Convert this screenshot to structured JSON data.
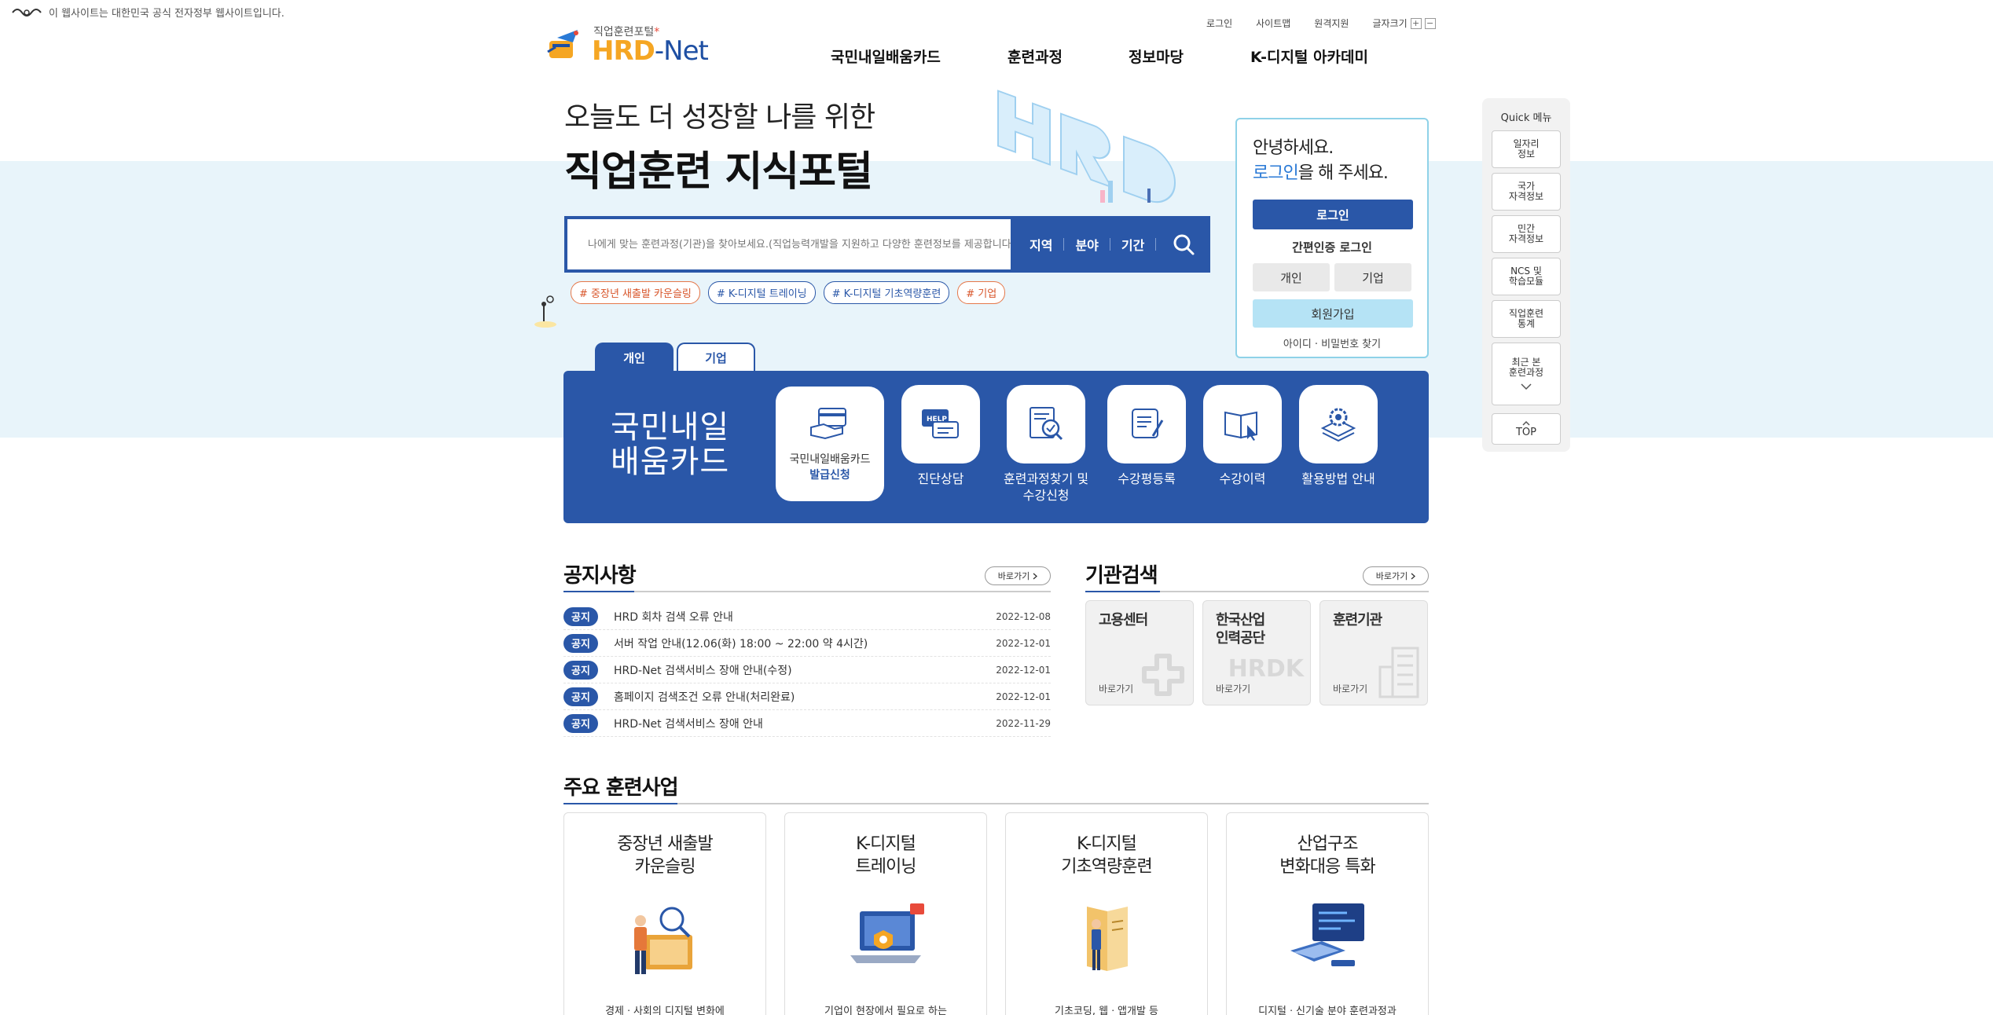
{
  "gov_banner": {
    "text": "이 웹사이트는 대한민국 공식 전자정부 웹사이트입니다."
  },
  "util_nav": {
    "login": "로그인",
    "sitemap": "사이트맵",
    "remote": "원격지원",
    "font_size": "글자크기",
    "plus": "+",
    "minus": "−"
  },
  "logo": {
    "sub": "직업훈련포털",
    "star": "*",
    "main": "HRD",
    "net": "Net",
    "dash": "-"
  },
  "gnb": [
    "국민내일배움카드",
    "훈련과정",
    "정보마당",
    "K-디지털 아카데미"
  ],
  "hero": {
    "line1": "오늘도 더 성장할 나를 위한",
    "line2": "직업훈련 지식포털"
  },
  "search": {
    "placeholder": "나에게 맞는 훈련과정(기관)을 찾아보세요.(직업능력개발을 지원하고 다양한 훈련정보를 제공합니다.)",
    "filters": [
      "지역",
      "분야",
      "기간"
    ]
  },
  "tags": [
    "# 중장년 새출발 카운슬링",
    "# K-디지털 트레이닝",
    "# K-디지털 기초역량훈련",
    "# 기업"
  ],
  "login_panel": {
    "hello": "안녕하세요.",
    "prompt_hl": "로그인",
    "prompt_rest": "을 해 주세요.",
    "login_button": "로그인",
    "simple_login": "간편인증 로그인",
    "personal": "개인",
    "company": "기업",
    "join": "회원가입",
    "find": "아이디 · 비밀번호 찾기"
  },
  "quick_menu": {
    "title": "Quick 메뉴",
    "items": [
      "일자리\n정보",
      "국가\n자격정보",
      "민간\n자격정보",
      "NCS 및\n학습모듈",
      "직업훈련\n통계",
      "최근 본\n훈련과정"
    ],
    "top": "TOP"
  },
  "tabs": [
    "개인",
    "기업"
  ],
  "card_panel": {
    "title_line1": "국민내일",
    "title_line2": "배움카드",
    "first": {
      "line1": "국민내일배움카드",
      "line2": "발급신청"
    },
    "services": [
      "진단상담",
      "훈련과정찾기 및\n수강신청",
      "수강평등록",
      "수강이력",
      "활용방법 안내"
    ]
  },
  "notice": {
    "title": "공지사항",
    "more": "바로가기",
    "rows": [
      {
        "badge": "공지",
        "title": "HRD 회차 검색 오류 안내",
        "date": "2022-12-08"
      },
      {
        "badge": "공지",
        "title": "서버 작업 안내(12.06(화) 18:00 ~ 22:00 약 4시간)",
        "date": "2022-12-01"
      },
      {
        "badge": "공지",
        "title": "HRD-Net 검색서비스 장애 안내(수정)",
        "date": "2022-12-01"
      },
      {
        "badge": "공지",
        "title": "홈페이지 검색조건 오류 안내(처리완료)",
        "date": "2022-12-01"
      },
      {
        "badge": "공지",
        "title": "HRD-Net 검색서비스 장애 안내",
        "date": "2022-11-29"
      }
    ]
  },
  "org_search": {
    "title": "기관검색",
    "more": "바로가기",
    "cards": [
      {
        "name": "고용센터",
        "go": "바로가기"
      },
      {
        "name": "한국산업\n인력공단",
        "go": "바로가기",
        "deco": "HRDK"
      },
      {
        "name": "훈련기관",
        "go": "바로가기"
      }
    ]
  },
  "training": {
    "title": "주요 훈련사업",
    "cards": [
      {
        "title": "중장년 새출발\n카운슬링",
        "desc": "경제ㆍ사회의 디지털 변화에"
      },
      {
        "title": "K-디지털\n트레이닝",
        "desc": "기업이 현장에서 필요로 하는"
      },
      {
        "title": "K-디지털\n기초역량훈련",
        "desc": "기초코딩, 웹ㆍ앱개발 등"
      },
      {
        "title": "산업구조\n변화대응 특화",
        "desc": "디지털ㆍ신기술 분야 훈련과정과"
      }
    ]
  },
  "colors": {
    "primary": "#2a57a8",
    "accent_orange": "#f5a623",
    "band": "#e8f4fa",
    "join_btn": "#b5e3f5"
  }
}
